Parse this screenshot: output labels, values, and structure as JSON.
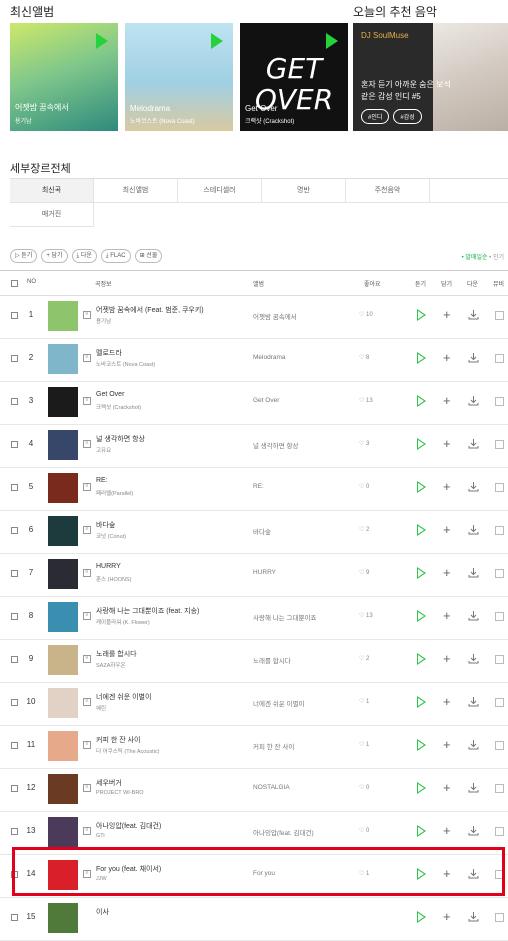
{
  "sections": {
    "latest_albums": "최신앨범",
    "today_recommend": "오늘의 추천 음악",
    "genre_all": "세부장르전체"
  },
  "albums": [
    {
      "title": "어젯밤 꿈속에서",
      "artist": "용기남"
    },
    {
      "title": "Melodrama",
      "artist": "노바코스트 (Nova Coast)"
    },
    {
      "title": "Get Over",
      "artist": "크랙샷 (Crackshot)"
    }
  ],
  "recommend": {
    "tag": "DJ SoulMuse",
    "title": "혼자 듣기 아까운 숨은 보석 같은 감성 인디 #5",
    "chips": [
      "#인디",
      "#감성"
    ]
  },
  "tabs": [
    "최신곡",
    "최신앨범",
    "스테디셀러",
    "명반",
    "주천음악",
    "매거진"
  ],
  "toolbar": [
    "듣기",
    "담기",
    "다운",
    "FLAC",
    "선물"
  ],
  "sort": {
    "active": "발매일순",
    "other": "인기"
  },
  "table_headers": {
    "no": "NO",
    "song": "곡정보",
    "album": "앨범",
    "like": "좋아요",
    "listen": "듣기",
    "add": "담기",
    "download": "다운",
    "more": "뮤비"
  },
  "rows": [
    {
      "num": "1",
      "song": "어젯밤 꿈속에서 (Feat. 범준, 쿠우키)",
      "artist": "용기남",
      "album": "어젯밤 꿈속에서",
      "likes": "10",
      "thumb": "#8ec46b"
    },
    {
      "num": "2",
      "song": "멜로드라",
      "artist": "노바코스트 (Nova Coast)",
      "album": "Melodrama",
      "likes": "8",
      "thumb": "#7fb6c9"
    },
    {
      "num": "3",
      "song": "Get Over",
      "artist": "크랙샷 (Crackshot)",
      "album": "Get Over",
      "likes": "13",
      "thumb": "#1b1b1b"
    },
    {
      "num": "4",
      "song": "널 생각하면 항상",
      "artist": "고유요",
      "album": "널 생각하면 항상",
      "likes": "3",
      "thumb": "#36476a"
    },
    {
      "num": "5",
      "song": "RE:",
      "artist": "패러렐(Parallel)",
      "album": "RE:",
      "likes": "0",
      "thumb": "#7a2a1c"
    },
    {
      "num": "6",
      "song": "바다숲",
      "artist": "코넛 (Conut)",
      "album": "바다숲",
      "likes": "2",
      "thumb": "#1d3a3d"
    },
    {
      "num": "7",
      "song": "HURRY",
      "artist": "훈스 (HOONS)",
      "album": "HURRY",
      "likes": "9",
      "thumb": "#2b2b33"
    },
    {
      "num": "8",
      "song": "사랑해 나는 그대뿐이죠 (feat. 지송)",
      "artist": "케이플라워 (K. Flower)",
      "album": "사랑해 나는 그대뿐이죠",
      "likes": "13",
      "thumb": "#3a8fb0"
    },
    {
      "num": "9",
      "song": "노래를 합시다",
      "artist": "SAZA하우온",
      "album": "노래를 합시다",
      "likes": "2",
      "thumb": "#c9b48a"
    },
    {
      "num": "10",
      "song": "너에겐 쉬운 이별이",
      "artist": "혜린",
      "album": "너에겐 쉬운 이별이",
      "likes": "1",
      "thumb": "#e2d2c6"
    },
    {
      "num": "11",
      "song": "커피 한 잔 사이",
      "artist": "더 어쿠스틱 (The Acoustic)",
      "album": "커피 한 잔 사이",
      "likes": "1",
      "thumb": "#e6a98a"
    },
    {
      "num": "12",
      "song": "세우버거",
      "artist": "PROJECT WI-BRO",
      "album": "NOSTALGIA",
      "likes": "0",
      "thumb": "#6a3a22"
    },
    {
      "num": "13",
      "song": "아나잉압(feat. 김대건)",
      "artist": "GTi",
      "album": "아나잉압(feat. 김대건)",
      "likes": "0",
      "thumb": "#4b3a5a"
    },
    {
      "num": "14",
      "song": "For you (feat. 채이서)",
      "artist": "JJW",
      "album": "For you",
      "likes": "1",
      "thumb": "#d81f2a"
    },
    {
      "num": "15",
      "song": "이사",
      "artist": "",
      "album": "",
      "likes": "",
      "thumb": "#4f7a3a"
    }
  ],
  "colors": {
    "accent": "#25d23a",
    "highlight": "#e3001b"
  }
}
